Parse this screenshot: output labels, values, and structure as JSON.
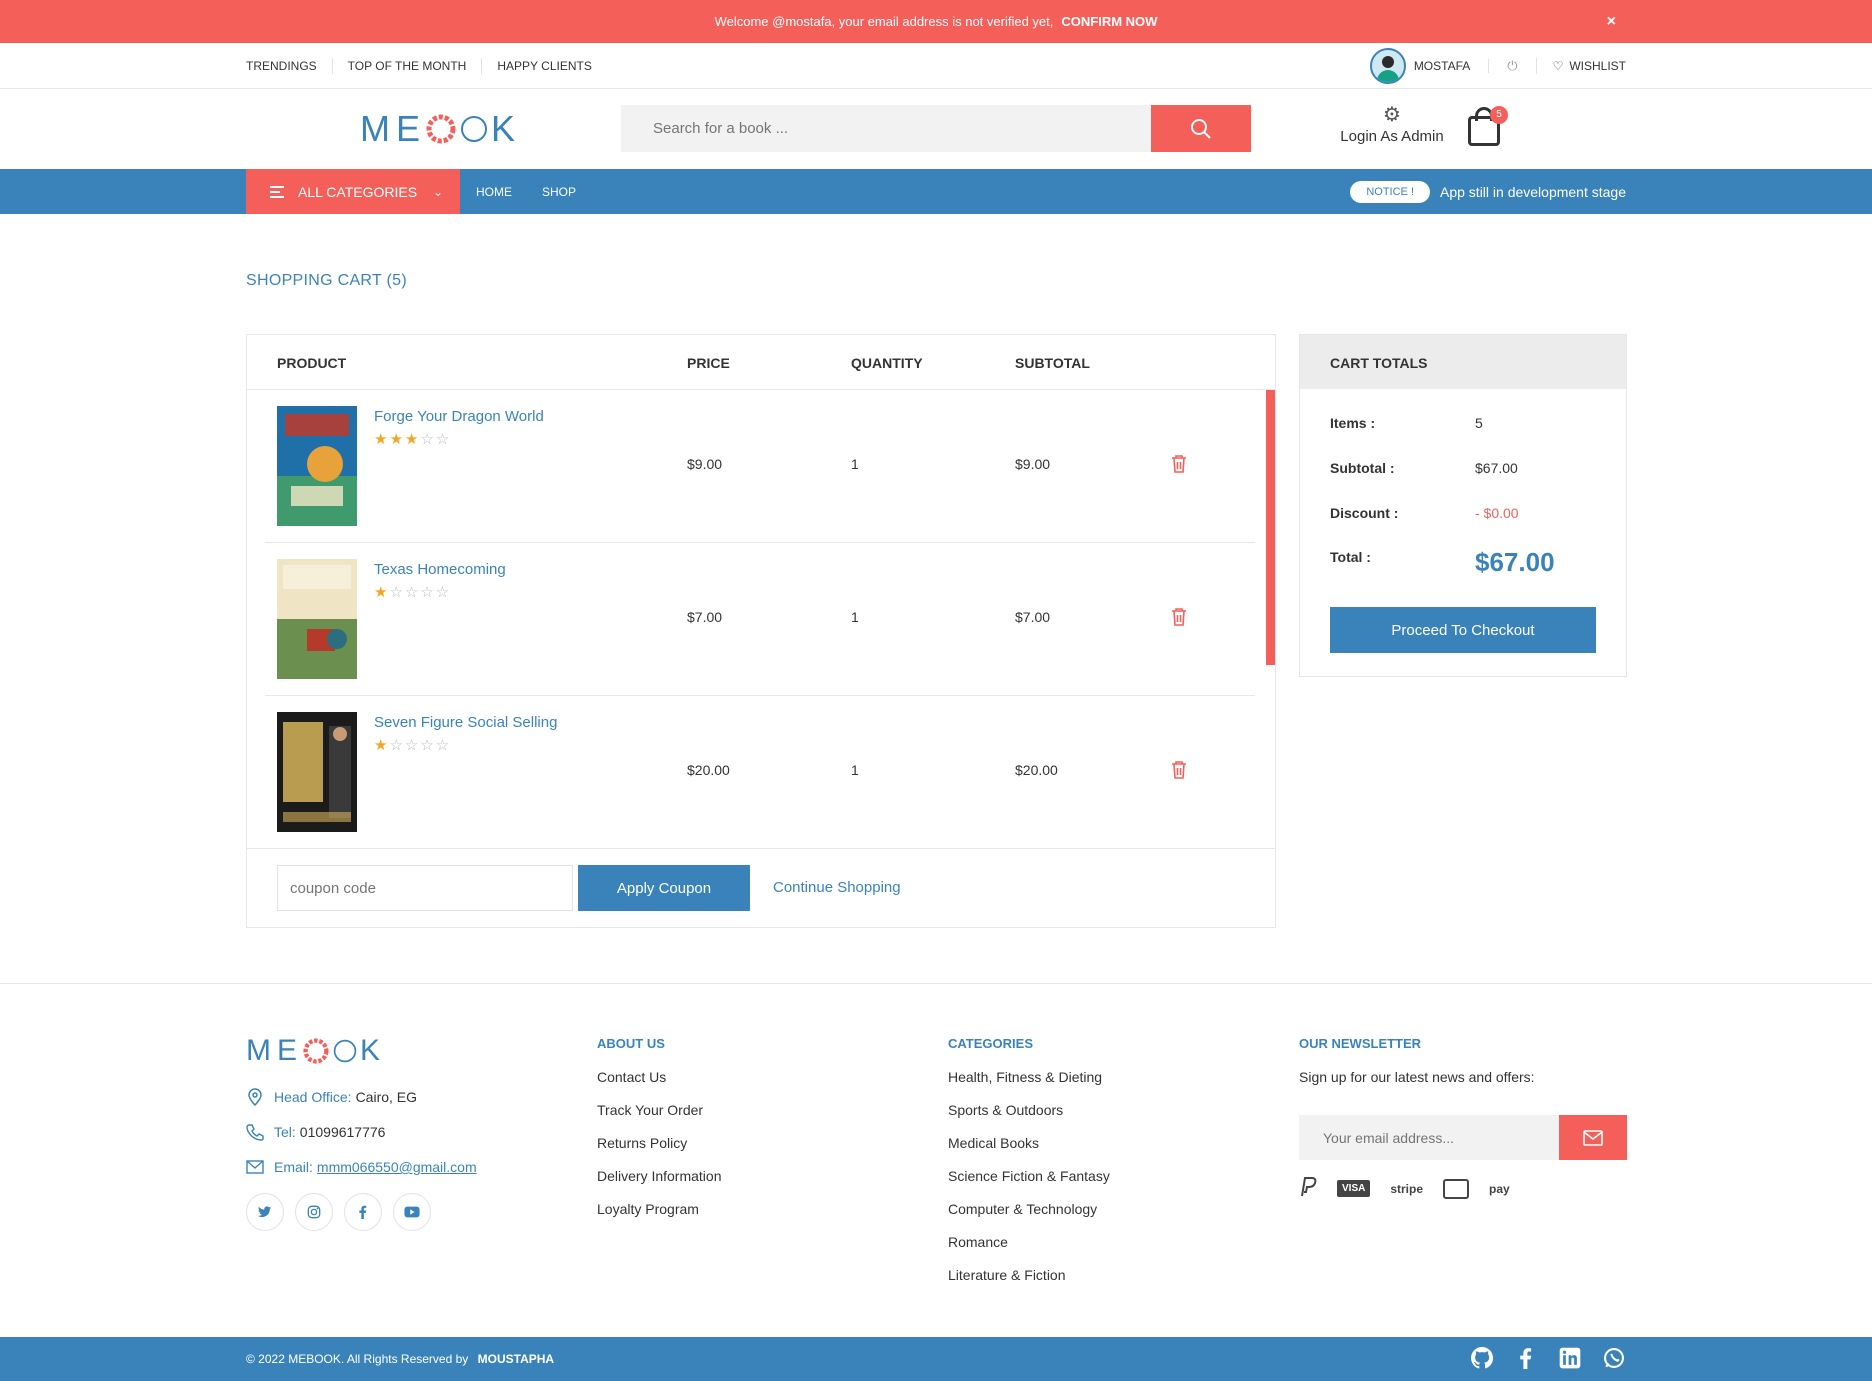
{
  "banner": {
    "message": "Welcome @mostafa, your email address is not verified yet,",
    "action": "CONFIRM NOW",
    "close": "×"
  },
  "toplinks": [
    "TRENDINGS",
    "TOP OF THE MONTH",
    "HAPPY CLIENTS"
  ],
  "user": {
    "name": "MOSTAFA",
    "power_icon": "⏻",
    "wishlist": "WISHLIST",
    "wish_icon": "♡"
  },
  "brand": {
    "logo_left": "ME",
    "logo_right": "K"
  },
  "search": {
    "placeholder": "Search for a book ..."
  },
  "admin": {
    "label": "Login As Admin",
    "icon": "gear-icon",
    "glyph": "⚙"
  },
  "cart_icon": {
    "count": "5"
  },
  "nav": {
    "all_categories": "ALL CATEGORIES",
    "links": [
      "HOME",
      "SHOP"
    ],
    "notice_pill": "NOTICE !",
    "notice_text": "App still in development stage",
    "chevron": "⌄"
  },
  "page": {
    "title": "SHOPPING CART (5)"
  },
  "table": {
    "headers": {
      "product": "PRODUCT",
      "price": "PRICE",
      "quantity": "QUANTITY",
      "subtotal": "SUBTOTAL"
    },
    "rows": [
      {
        "name": "Forge Your Dragon World",
        "rating": 3,
        "price": "$9.00",
        "qty": "1",
        "subtotal": "$9.00",
        "cover_color": "#1f6fa8",
        "cover_accent": "#e8a23a"
      },
      {
        "name": "Texas Homecoming",
        "rating": 1,
        "price": "$7.00",
        "qty": "1",
        "subtotal": "$7.00",
        "cover_color": "#efe4c4",
        "cover_accent": "#b53a2b"
      },
      {
        "name": "Seven Figure Social Selling",
        "rating": 1,
        "price": "$20.00",
        "qty": "1",
        "subtotal": "$20.00",
        "cover_color": "#1b1b1b",
        "cover_accent": "#d6b35a"
      }
    ]
  },
  "coupon": {
    "placeholder": "coupon code",
    "apply": "Apply Coupon",
    "continue": "Continue Shopping"
  },
  "totals": {
    "title": "CART TOTALS",
    "items_label": "Items :",
    "items": "5",
    "subtotal_label": "Subtotal :",
    "subtotal": "$67.00",
    "discount_label": "Discount :",
    "discount": "- $0.00",
    "total_label": "Total :",
    "total": "$67.00",
    "checkout": "Proceed To Checkout"
  },
  "footer": {
    "office_label": "Head Office:",
    "office": "Cairo, EG",
    "tel_label": "Tel:",
    "tel": "01099617776",
    "email_label": "Email:",
    "email": "mmm066550@gmail.com",
    "socials": [
      "twitter-icon",
      "instagram-icon",
      "facebook-icon",
      "youtube-icon"
    ],
    "about_title": "ABOUT US",
    "about_links": [
      "Contact Us",
      "Track Your Order",
      "Returns Policy",
      "Delivery Information",
      "Loyalty Program"
    ],
    "categories_title": "CATEGORIES",
    "categories": [
      "Health, Fitness & Dieting",
      "Sports & Outdoors",
      "Medical Books",
      "Science Fiction & Fantasy",
      "Computer & Technology",
      "Romance",
      "Literature & Fiction"
    ],
    "newsletter_title": "OUR NEWSLETTER",
    "newsletter_text": "Sign up for our latest news and offers:",
    "newsletter_placeholder": "Your email address...",
    "payments": [
      "stripe",
      "pay"
    ]
  },
  "bottom": {
    "copyright": "© 2022 MEBOOK. All Rights Reserved by",
    "author": "MOUSTAPHA"
  },
  "colors": {
    "primary": "#3a83ba",
    "accent": "#f55f5a"
  }
}
